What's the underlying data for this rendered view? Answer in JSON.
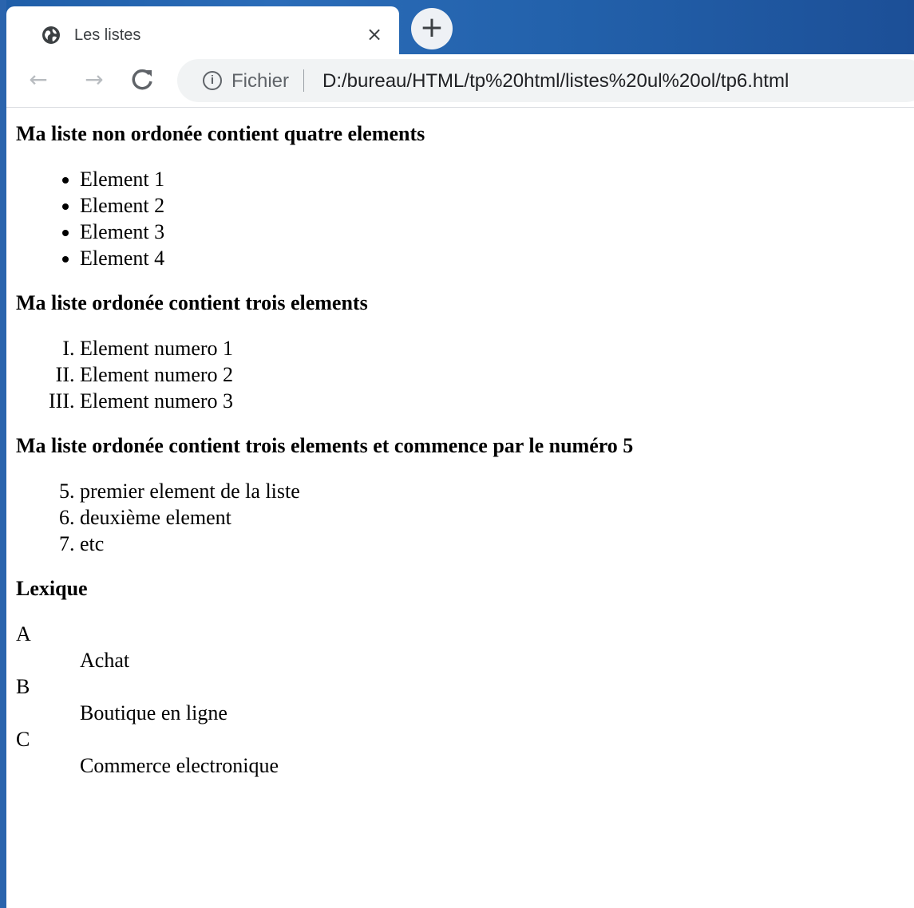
{
  "browser": {
    "tab_title": "Les listes",
    "tab_close": "×",
    "new_tab": "+",
    "back": "←",
    "forward": "→",
    "reload": "C",
    "info": "i",
    "scheme_label": "Fichier",
    "url": "D:/bureau/HTML/tp%20html/listes%20ul%20ol/tp6.html",
    "favicon": "globe-icon"
  },
  "page": {
    "section1": {
      "heading": "Ma liste non ordonée contient quatre elements",
      "items": [
        "Element 1",
        "Element 2",
        "Element 3",
        "Element 4"
      ]
    },
    "section2": {
      "heading": "Ma liste ordonée contient trois elements",
      "items": [
        "Element numero 1",
        "Element numero 2",
        "Element numero 3"
      ]
    },
    "section3": {
      "heading": "Ma liste ordonée contient trois elements et commence par le numéro 5",
      "start": 5,
      "items": [
        "premier element de la liste",
        "deuxième element",
        "etc"
      ]
    },
    "section4": {
      "heading": "Lexique",
      "terms": [
        {
          "term": "A",
          "definition": "Achat"
        },
        {
          "term": "B",
          "definition": "Boutique en ligne"
        },
        {
          "term": "C",
          "definition": "Commerce electronique"
        }
      ]
    }
  }
}
